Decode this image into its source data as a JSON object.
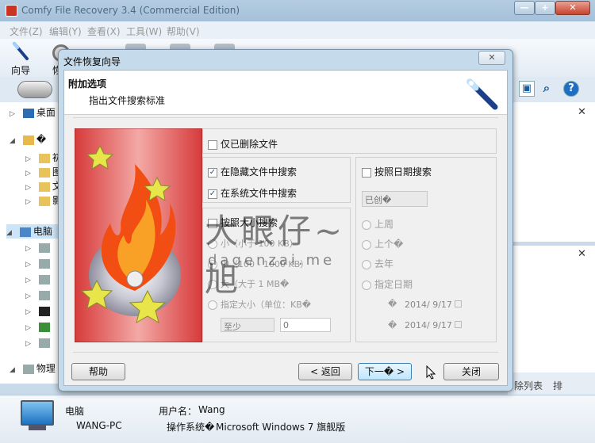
{
  "window": {
    "title": "Comfy File Recovery 3.4 (Commercial Edition)",
    "buttons": {
      "minimize": "—",
      "maximize": "+",
      "close": "✕"
    }
  },
  "menu": [
    "文件(Z)",
    "编辑(Y)",
    "查看(X)",
    "工具(W)",
    "帮助(V)"
  ],
  "toolbar": {
    "wizard_label": "向导",
    "second_label": "恢"
  },
  "nav": {
    "save_icon": "save-icon",
    "search_icon": "search-icon",
    "help_label": "?"
  },
  "tree": {
    "desktop": "桌面",
    "computer": "电脑",
    "physical": "物理",
    "collapsed_items": [
      "�",
      "初",
      "图",
      "文",
      "影"
    ]
  },
  "right_pane": {
    "close_symbol": "✕",
    "list_label": "除列表",
    "tb_label": "排"
  },
  "status": {
    "computer_label": "电脑",
    "computer_name": "WANG-PC",
    "user_label": "用户名：",
    "user_value": "Wang",
    "os_label": "操作系统�",
    "os_value": "Microsoft Windows 7 旗舰版"
  },
  "dialog": {
    "title": "文件恢复向导",
    "close": "✕",
    "header_title": "附加选项",
    "header_subtitle": "指出文件搜索标准",
    "only_deleted": "仅已删除文件",
    "hidden_files": "在隐藏文件中搜索",
    "system_files": "在系统文件中搜索",
    "by_size": "按照大小搜索",
    "size_small": "小（小于 100 KB）",
    "size_medium": "中（100 - 1000 KB）",
    "size_large": "大（大于 1 MB�",
    "size_custom": "指定大小（单位：KB�",
    "size_min_label": "至少",
    "size_min_value": "0",
    "by_date": "按照日期搜索",
    "date_type": "已创�",
    "date_last_week": "上周",
    "date_last_month": "上个�",
    "date_last_year": "去年",
    "date_custom": "指定日期",
    "date_from_prefix": "�",
    "date_from": "2014/ 9/17",
    "date_to_prefix": "�",
    "date_to": "2014/ 9/17",
    "btn_help": "帮助",
    "btn_back": "< 返回",
    "btn_next": "下一� >",
    "btn_close": "关闭",
    "checked": {
      "only_deleted": false,
      "hidden_files": true,
      "system_files": true,
      "by_size": false,
      "by_date": false
    }
  },
  "watermark": {
    "main": "大眼仔~旭",
    "sub": "dagenzai.me"
  }
}
